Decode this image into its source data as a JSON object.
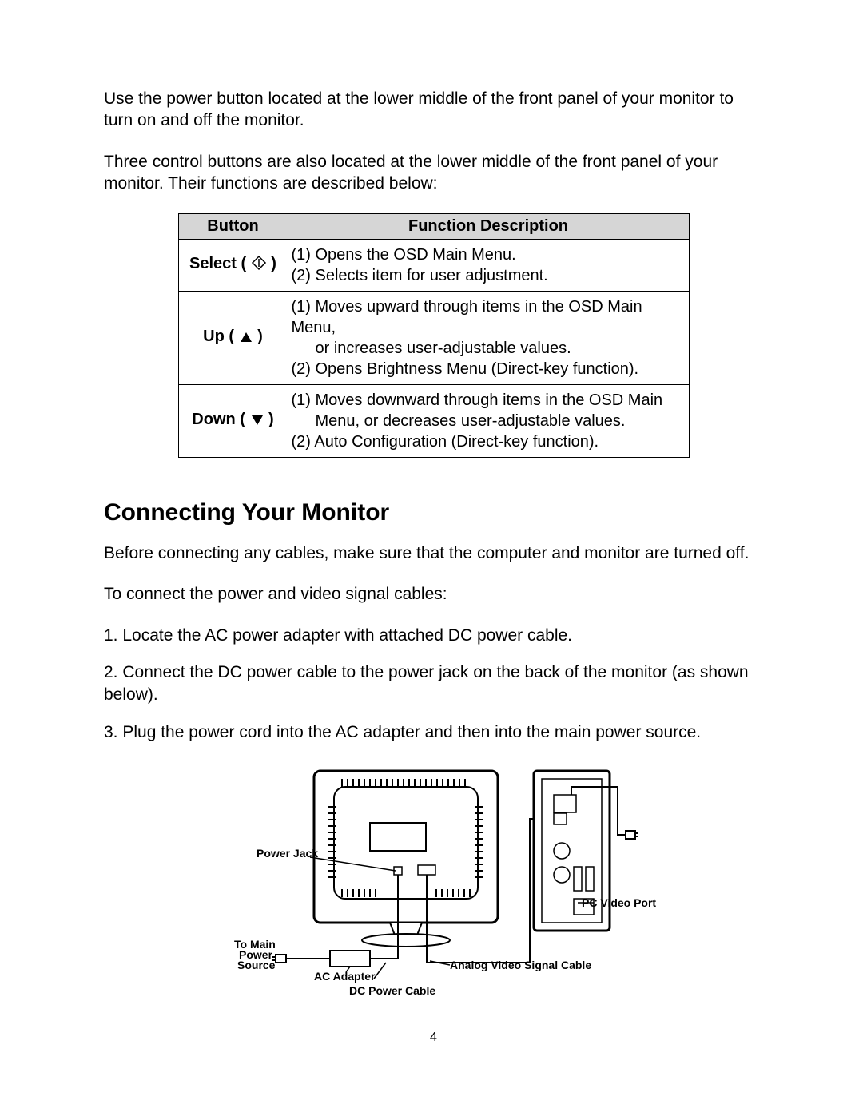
{
  "intro": {
    "p1": "Use the power button located at the lower middle of the front panel of your monitor to turn on and off the monitor.",
    "p2": "Three control buttons are also located at the lower middle of the front panel of your monitor. Their functions are described below:"
  },
  "table": {
    "head_button": "Button",
    "head_desc": "Function Description",
    "rows": [
      {
        "button_prefix": "Select ( ",
        "button_suffix": " )",
        "icon": "select",
        "desc_line1": "(1) Opens the OSD Main Menu.",
        "desc_line2": "(2) Selects item for user adjustment."
      },
      {
        "button_prefix": "Up ( ",
        "button_suffix": " )",
        "icon": "up",
        "desc_line1": "(1) Moves upward through items in the OSD Main Menu,",
        "desc_line1b": "or increases user-adjustable values.",
        "desc_line2": "(2) Opens Brightness Menu (Direct-key function)."
      },
      {
        "button_prefix": "Down ( ",
        "button_suffix": " )",
        "icon": "down",
        "desc_line1": "(1) Moves downward through items in the OSD Main",
        "desc_line1b": "Menu, or decreases user-adjustable values.",
        "desc_line2": "(2) Auto Configuration (Direct-key function)."
      }
    ]
  },
  "heading": "Connecting Your Monitor",
  "connect": {
    "p1": "Before connecting any cables, make sure that the computer and monitor are turned off.",
    "p2": "To connect the power and video signal cables:",
    "step1": "1. Locate the AC power adapter with attached DC power cable.",
    "step2": "2. Connect the DC power cable to the power jack on the back of the monitor (as shown below).",
    "step3": "3. Plug the power cord into the AC adapter and then into the main power source."
  },
  "diagram": {
    "power_jack": "Power Jack",
    "to_main1": "To Main",
    "to_main2": "Power",
    "to_main3": "Source",
    "ac_adapter": "AC Adapter",
    "dc_cable": "DC Power Cable",
    "analog_cable": "Analog Video Signal Cable",
    "pc_port": "PC Video Port"
  },
  "page_number": "4"
}
